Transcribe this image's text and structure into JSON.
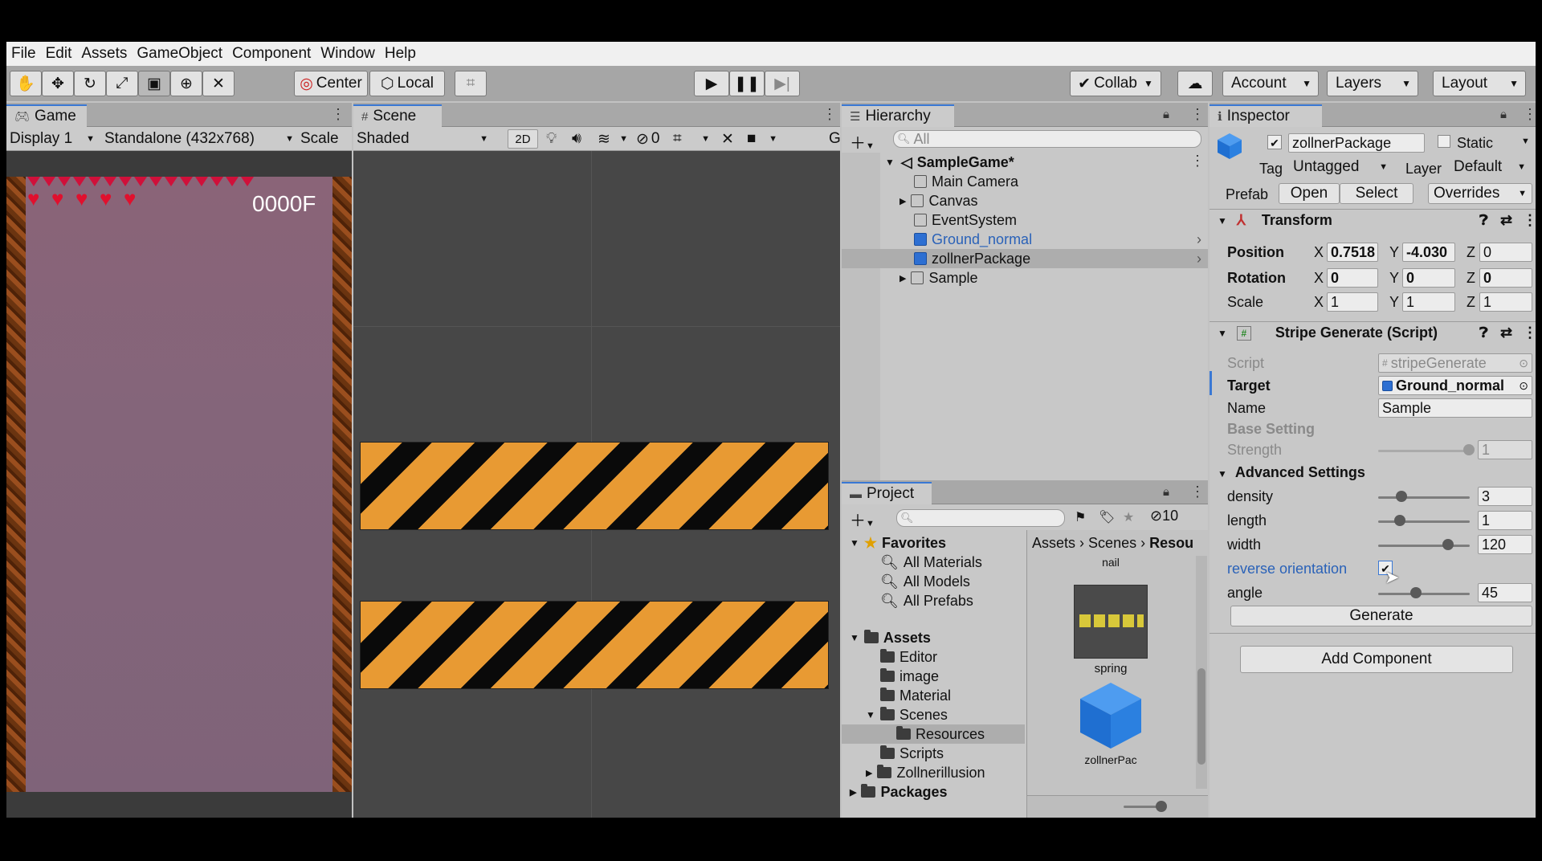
{
  "menu": [
    "File",
    "Edit",
    "Assets",
    "GameObject",
    "Component",
    "Window",
    "Help"
  ],
  "toolbar": {
    "pivot_label": "Center",
    "space_label": "Local",
    "collab_label": "Collab",
    "account_label": "Account",
    "layers_label": "Layers",
    "layout_label": "Layout"
  },
  "game": {
    "tab_label": "Game",
    "display": "Display 1",
    "resolution": "Standalone (432x768)",
    "scale_label": "Scale",
    "score": "0000F",
    "hearts": 5
  },
  "scene": {
    "tab_label": "Scene",
    "shading": "Shaded",
    "mode_2d": "2D",
    "hidden_count": "0",
    "gizmos_label": "G"
  },
  "hierarchy": {
    "tab_label": "Hierarchy",
    "search_placeholder": "All",
    "scene_name": "SampleGame*",
    "items": [
      {
        "label": "Main Camera",
        "color": "#111111"
      },
      {
        "label": "Canvas",
        "color": "#111111"
      },
      {
        "label": "EventSystem",
        "color": "#111111"
      },
      {
        "label": "Ground_normal",
        "color": "#2a62b8"
      },
      {
        "label": "zollnerPackage",
        "color": "#111111"
      },
      {
        "label": "Sample",
        "color": "#111111"
      }
    ]
  },
  "project": {
    "tab_label": "Project",
    "hidden_count": "10",
    "favorites_label": "Favorites",
    "favorites": [
      "All Materials",
      "All Models",
      "All Prefabs"
    ],
    "assets_label": "Assets",
    "folders": [
      "Editor",
      "image",
      "Material",
      "Scenes",
      "Resources",
      "Scripts",
      "Zollnerillusion"
    ],
    "packages_label": "Packages",
    "breadcrumb": [
      "Assets",
      "Scenes",
      "Resou"
    ],
    "grid_items": [
      "nail",
      "spring",
      "zollnerPac"
    ]
  },
  "inspector": {
    "tab_label": "Inspector",
    "object_name": "zollnerPackage",
    "static_label": "Static",
    "tag_label": "Tag",
    "tag_value": "Untagged",
    "layer_label": "Layer",
    "layer_value": "Default",
    "prefab_label": "Prefab",
    "open_label": "Open",
    "select_label": "Select",
    "overrides_label": "Overrides",
    "transform": {
      "title": "Transform",
      "position_label": "Position",
      "rotation_label": "Rotation",
      "scale_label": "Scale",
      "axis_x": "X",
      "axis_y": "Y",
      "axis_z": "Z",
      "position": [
        "0.7518",
        "-4.030",
        "0"
      ],
      "rotation": [
        "0",
        "0",
        "0"
      ],
      "scale": [
        "1",
        "1",
        "1"
      ]
    },
    "script_component": {
      "title": "Stripe Generate (Script)",
      "script_label": "Script",
      "script_value": "stripeGenerate",
      "target_label": "Target",
      "target_value": "Ground_normal",
      "name_label": "Name",
      "name_value": "Sample",
      "base_setting_label": "Base Setting",
      "strength_label": "Strength",
      "strength_value": "1",
      "advanced_label": "Advanced Settings",
      "density_label": "density",
      "density_value": "3",
      "length_label": "length",
      "length_value": "1",
      "width_label": "width",
      "width_value": "120",
      "reverse_label": "reverse orientation",
      "angle_label": "angle",
      "angle_value": "45",
      "generate_label": "Generate"
    },
    "add_component_label": "Add Component"
  },
  "colors": {
    "accent": "#3a78d4",
    "stripe_orange": "#e89a33",
    "heart": "#e0102e"
  }
}
